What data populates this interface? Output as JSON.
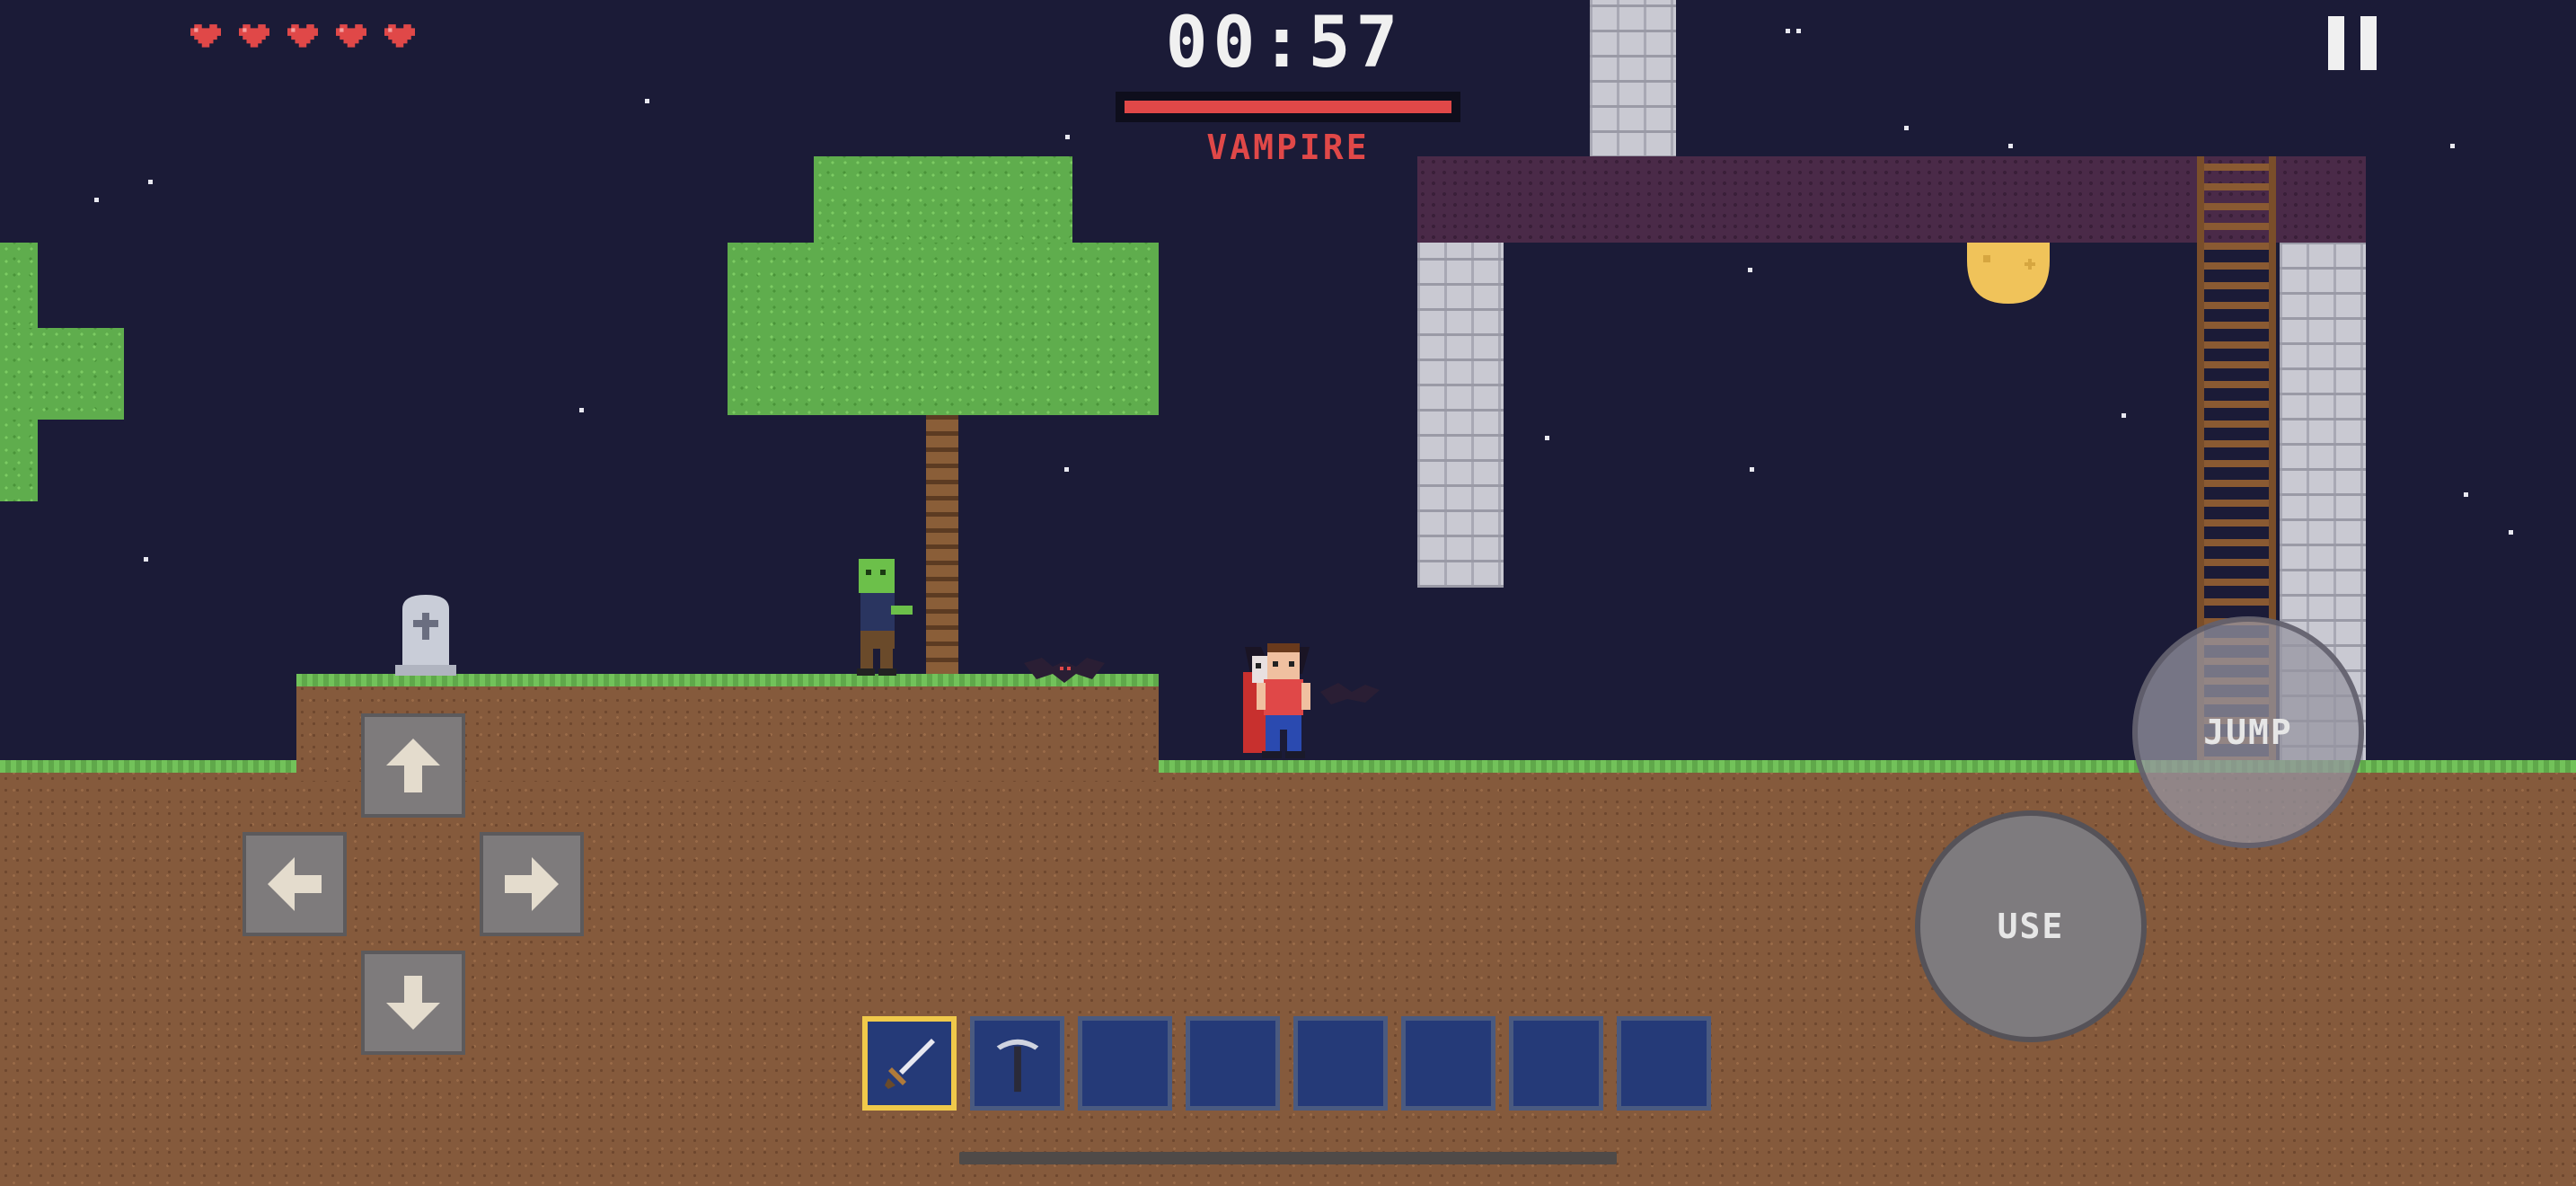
{
  "hud": {
    "timer": "00:57",
    "boss_name": "VAMPIRE",
    "boss_health_fraction": 1.0,
    "hearts": 5,
    "pause_icon": "pause-icon"
  },
  "controls": {
    "dpad": [
      "arrow-up-icon",
      "arrow-left-icon",
      "arrow-right-icon",
      "arrow-down-icon"
    ],
    "use_label": "USE",
    "jump_label": "JUMP"
  },
  "hotbar": {
    "selected_index": 0,
    "slots": [
      "sword-icon",
      "pickaxe-icon",
      "",
      "",
      "",
      "",
      "",
      ""
    ]
  },
  "colors": {
    "sky": "#1b1b37",
    "health_bar": "#e04848",
    "boss_name": "#e04848",
    "hotbar_selected": "#f0c94a"
  }
}
